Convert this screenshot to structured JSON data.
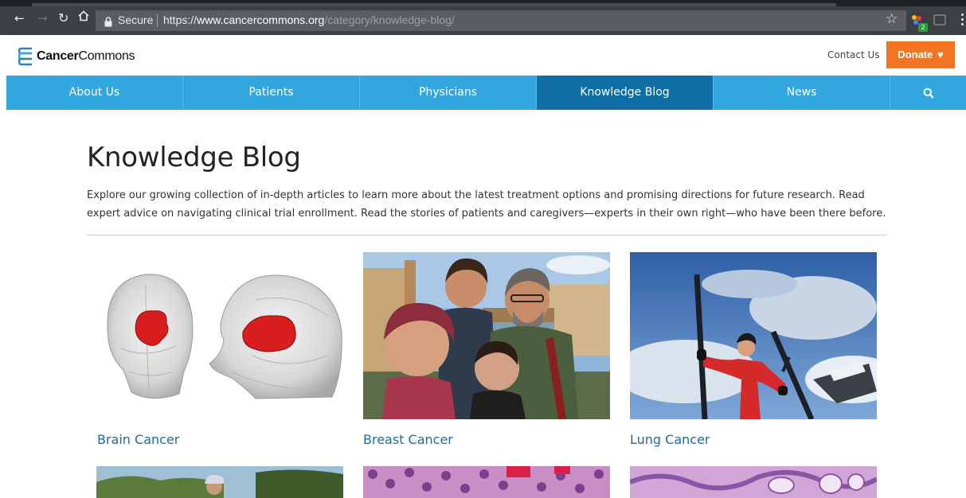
{
  "browser": {
    "secure_label": "Secure",
    "url_scheme": "https://",
    "url_host": "www.cancercommons.org",
    "url_path": "/category/knowledge-blog/",
    "extension_badge": "2"
  },
  "header": {
    "logo_bold": "Cancer",
    "logo_rest": "Commons",
    "contact_label": "Contact Us",
    "donate_label": "Donate"
  },
  "nav": {
    "items": [
      {
        "label": "About Us"
      },
      {
        "label": "Patients"
      },
      {
        "label": "Physicians"
      },
      {
        "label": "Knowledge Blog"
      },
      {
        "label": "News"
      }
    ],
    "active": "Knowledge Blog"
  },
  "page": {
    "title": "Knowledge Blog",
    "intro": "Explore our growing collection of in-depth articles to learn more about the latest treatment options and promising directions for future research. Read expert advice on navigating clinical trial enrollment. Read the stories of patients and caregivers—experts in their own right—who have been there before."
  },
  "cards": [
    {
      "title": "Brain Cancer"
    },
    {
      "title": "Breast Cancer"
    },
    {
      "title": "Lung Cancer"
    }
  ],
  "colors": {
    "nav_blue": "#31a6df",
    "nav_active": "#0f6ea4",
    "donate_orange": "#f47421",
    "link_blue": "#1a6ea6"
  }
}
